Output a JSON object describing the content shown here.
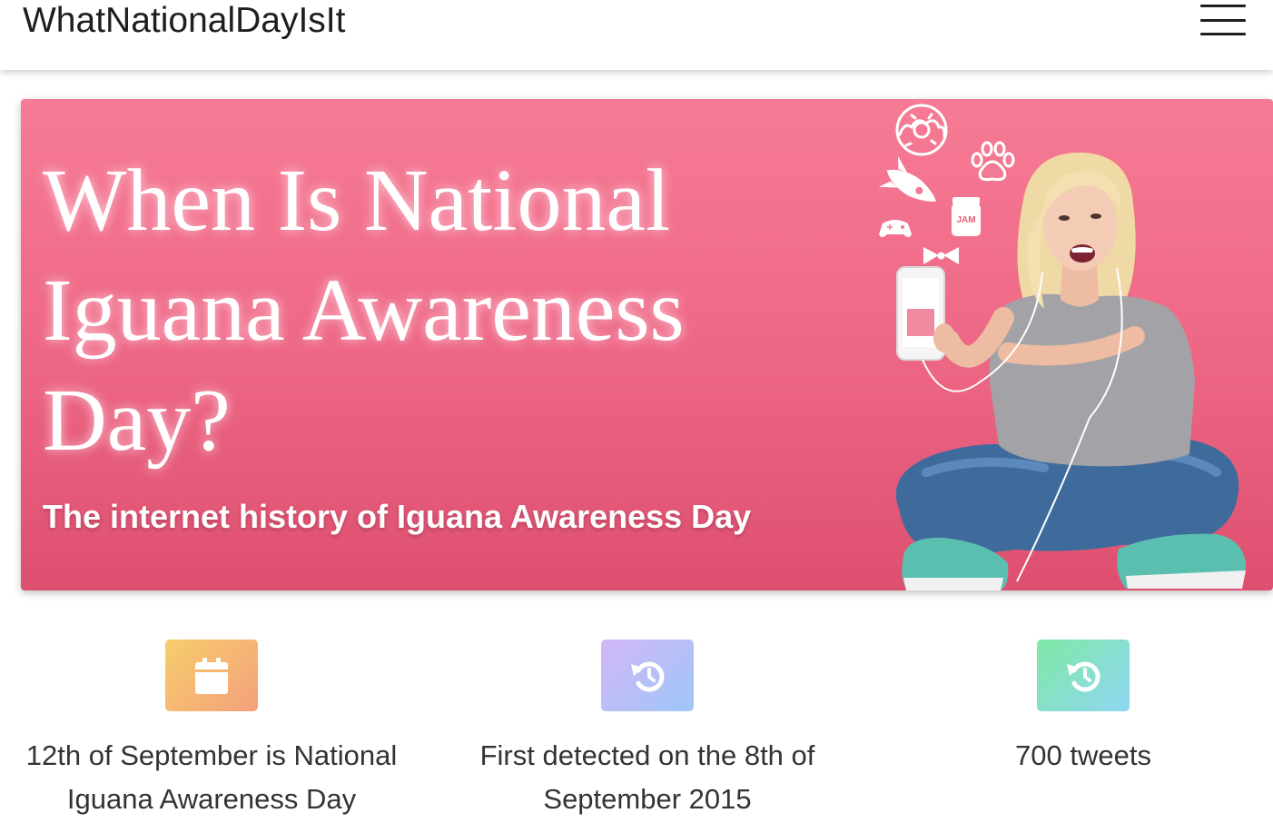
{
  "header": {
    "brand": "WhatNationalDayIsIt",
    "menu_icon": "hamburger-menu-icon"
  },
  "hero": {
    "title": "When Is National Iguana Awareness Day?",
    "subtitle": "The internet history of Iguana Awareness Day",
    "gradient": [
      "#f67b95",
      "#ee6886",
      "#de4f6f"
    ],
    "illustration": {
      "jar_label": "JAM",
      "icons": [
        "donut-icon",
        "paw-icon",
        "rocket-icon",
        "gamepad-icon",
        "jam-jar-icon",
        "bow-tie-icon"
      ]
    }
  },
  "features": [
    {
      "icon": "calendar-icon",
      "text": "12th of September is National Iguana Awareness Day",
      "gradient": [
        "#f7cd6b",
        "#f4a07d"
      ]
    },
    {
      "icon": "history-icon",
      "text": "First detected on the 8th of September 2015",
      "gradient": [
        "#d2b7f7",
        "#9fc6f7"
      ]
    },
    {
      "icon": "history-icon",
      "text": "700 tweets",
      "gradient": [
        "#7fe9a5",
        "#8fd6f2"
      ]
    }
  ]
}
